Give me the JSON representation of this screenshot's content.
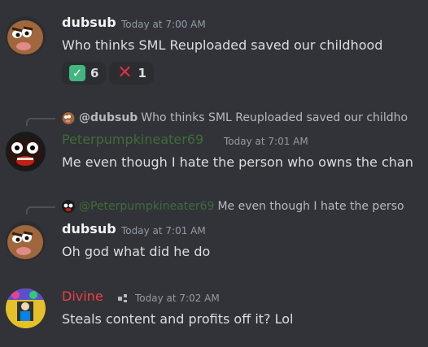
{
  "messages": [
    {
      "author": "dubsub",
      "timestamp": "Today at 7:00 AM",
      "text": "Who thinks SML Reuploaded saved our childhood",
      "reactions": [
        {
          "emoji": "✓",
          "emoji_name": "check-mark-button",
          "count": "6"
        },
        {
          "emoji": "✕",
          "emoji_name": "cross-mark",
          "count": "1"
        }
      ]
    },
    {
      "reply_to": {
        "author": "@dubsub",
        "text": "Who thinks SML Reuploaded saved our childho"
      },
      "author": "Peterpumpkineater69",
      "author_color": "#3f6b3a",
      "timestamp": "Today at 7:01 AM",
      "text": "Me even though I hate the person who owns the chan"
    },
    {
      "reply_to": {
        "author": "@Peterpumpkineater69",
        "author_color": "#3f6b3a",
        "text": "Me even though I hate the perso"
      },
      "author": "dubsub",
      "timestamp": "Today at 7:01 AM",
      "text": "Oh god what did he do"
    },
    {
      "author": "Divine",
      "author_color": "#f23f43",
      "role_icon": "bot-badge-icon",
      "timestamp": "Today at 7:02 AM",
      "text": "Steals content and profits off it? Lol"
    }
  ]
}
